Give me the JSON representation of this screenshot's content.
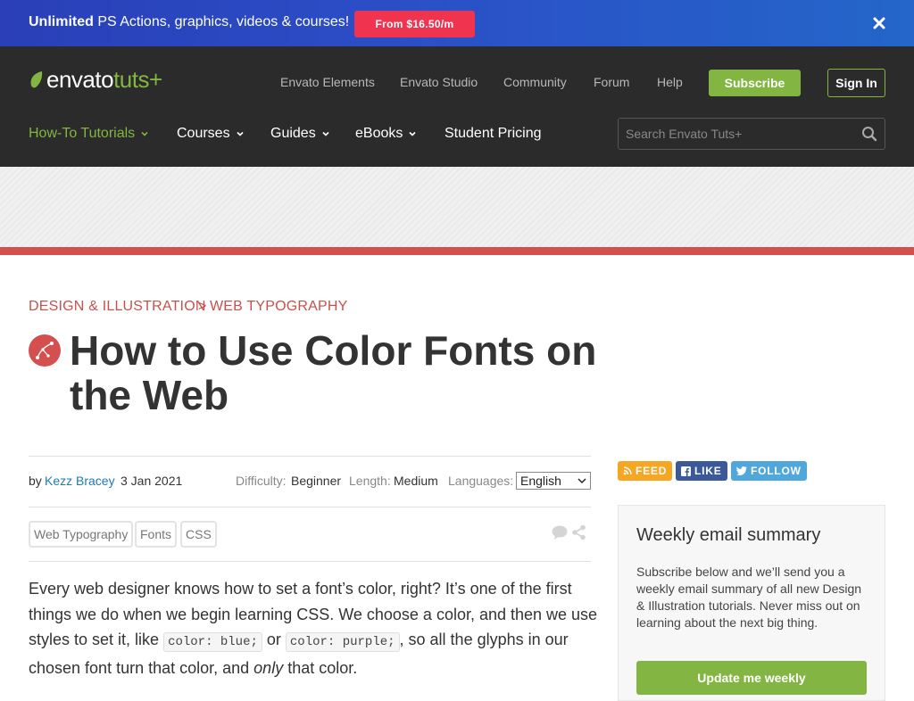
{
  "promo": {
    "bold": "Unlimited",
    "text": " PS Actions, graphics, videos & courses!",
    "cta": "From $16.50/m"
  },
  "header": {
    "logo_a": "envato",
    "logo_b": "tuts+",
    "top_links": [
      "Envato Elements",
      "Envato Studio",
      "Community",
      "Forum",
      "Help"
    ],
    "subscribe": "Subscribe",
    "sign_in": "Sign In",
    "main_nav": [
      {
        "label": "How-To Tutorials",
        "active": true
      },
      {
        "label": "Courses"
      },
      {
        "label": "Guides"
      },
      {
        "label": "eBooks"
      },
      {
        "label": "Student Pricing"
      }
    ],
    "search_placeholder": "Search Envato Tuts+"
  },
  "article": {
    "breadcrumb": [
      "DESIGN & ILLUSTRATION",
      ">",
      "WEB TYPOGRAPHY"
    ],
    "title": "How to Use Color Fonts on the Web",
    "meta": {
      "by": "by",
      "author": "Kezz Bracey",
      "date": "3 Jan 2021",
      "difficulty_label": "Difficulty:",
      "difficulty": "Beginner",
      "length_label": "Length:",
      "length": "Medium",
      "languages_label": "Languages:",
      "language": "English"
    },
    "tags": [
      "Web Typography",
      "Fonts",
      "CSS"
    ],
    "body": {
      "p1": "Every web designer knows how to set a font’s color, right? It’s one of the first things we do when we begin learning CSS. We choose a color, and then we use styles to set it, like ",
      "code1": "color: blue;",
      "p2": " or ",
      "code2": "color: purple;",
      "p3": ", so all the glyphs in our chosen font turn that color, and ",
      "em": "only",
      "p4": " that color."
    }
  },
  "sidebar": {
    "social": [
      {
        "label": "FEED",
        "color": "#f5a623"
      },
      {
        "label": "LIKE",
        "color": "#3b5998"
      },
      {
        "label": "FOLLOW",
        "color": "#4fa7dc"
      }
    ],
    "email": {
      "title": "Weekly email summary",
      "desc": "Subscribe below and we’ll send you a weekly email summary of all new Design & Illustration tutorials. Never miss out on learning about the next big thing.",
      "button": "Update me weekly"
    }
  },
  "colors": {
    "brand_green": "#82b541",
    "accent_red": "#d4504e",
    "promo_cta": "#f0334f"
  }
}
